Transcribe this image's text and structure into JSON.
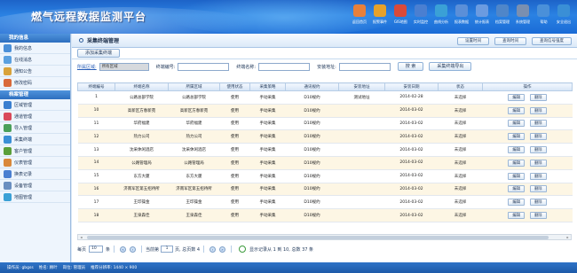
{
  "app": {
    "title": "燃气远程数据监测平台"
  },
  "nav": [
    {
      "label": "返回首页",
      "icon": "home-icon",
      "color": "#e8803a"
    },
    {
      "label": "报警事件",
      "icon": "alarm-bell-icon",
      "color": "#e6a12a"
    },
    {
      "label": "GIS地图",
      "icon": "map-icon",
      "color": "#d94a3a"
    },
    {
      "label": "实时监控",
      "icon": "monitor-icon",
      "color": "#4a7fd1"
    },
    {
      "label": "曲线分析",
      "icon": "curve-chart-icon",
      "color": "#3aa0d6"
    },
    {
      "label": "报表数据",
      "icon": "report-icon",
      "color": "#5b8fd8"
    },
    {
      "label": "统计报表",
      "icon": "statistics-icon",
      "color": "#6b9be0"
    },
    {
      "label": "档案管理",
      "icon": "archive-icon",
      "color": "#4f86c9"
    },
    {
      "label": "系统管理",
      "icon": "system-gear-icon",
      "color": "#7a8fb0"
    },
    {
      "label": "帮助",
      "icon": "help-icon",
      "color": "#4a90d9"
    },
    {
      "label": "安全退出",
      "icon": "logout-icon",
      "color": "#3a8fd6"
    }
  ],
  "sidebar": {
    "header": "我的信息",
    "items": [
      {
        "label": "我的信息",
        "icon": "user-info-icon",
        "color": "#4a8fd8"
      },
      {
        "label": "在线消息",
        "icon": "message-icon",
        "color": "#5aa0e0"
      },
      {
        "label": "通知公告",
        "icon": "notice-icon",
        "color": "#d9a23a"
      },
      {
        "label": "修改密码",
        "icon": "password-icon",
        "color": "#d96a3a"
      }
    ],
    "header2": "档案管理",
    "items2": [
      {
        "label": "区域管理",
        "icon": "region-icon",
        "color": "#3a7fd0"
      },
      {
        "label": "通道管理",
        "icon": "channel-icon",
        "color": "#d94a5a"
      },
      {
        "label": "导入管理",
        "icon": "import-icon",
        "color": "#4aa05a"
      },
      {
        "label": "采集终端",
        "icon": "terminal-icon",
        "color": "#3a8fd6"
      },
      {
        "label": "客户管理",
        "icon": "customer-icon",
        "color": "#5a9f3a"
      },
      {
        "label": "仪表管理",
        "icon": "meter-icon",
        "color": "#d9883a"
      },
      {
        "label": "换表记录",
        "icon": "swap-record-icon",
        "color": "#4a7fd1"
      },
      {
        "label": "设备管理",
        "icon": "device-icon",
        "color": "#6a8fc0"
      },
      {
        "label": "地图管理",
        "icon": "map-manage-icon",
        "color": "#3aa0d6"
      }
    ]
  },
  "page": {
    "title": "采集终端管理",
    "top_buttons": [
      "设置时间",
      "查询时间",
      "查询信号强度"
    ],
    "add_button": "添加采集终端",
    "filters": {
      "region_label": "所属区域:",
      "region_value": "所有区域",
      "terminal_no_label": "终端编号:",
      "terminal_name_label": "终端名称:",
      "install_addr_label": "安装地址:",
      "search_button": "搜 索",
      "export_button": "采集终端导出"
    }
  },
  "table": {
    "headers": [
      "终端编号",
      "终端名称",
      "所属区域",
      "使用状态",
      "采集策略",
      "通讯规约",
      "安装地址",
      "安装日期",
      "状态",
      "操作"
    ],
    "rows": [
      [
        "1",
        "公路总部学院",
        "公路总部学院",
        "使用",
        "手动采集",
        "D10规约",
        "测试地址",
        "2014-02-28",
        "未选择"
      ],
      [
        "10",
        "高新区方春新苑",
        "高新区方春新苑",
        "使用",
        "手动采集",
        "D10规约",
        "",
        "2014-03-02",
        "未选择"
      ],
      [
        "11",
        "华府福建",
        "华府福建",
        "使用",
        "手动采集",
        "D10规约",
        "",
        "2014-03-02",
        "未选择"
      ],
      [
        "12",
        "热力公司",
        "热力公司",
        "使用",
        "手动采集",
        "D10规约",
        "",
        "2014-03-02",
        "未选择"
      ],
      [
        "13",
        "沈采休闲酒店",
        "沈采休闲酒店",
        "使用",
        "手动采集",
        "D10规约",
        "",
        "2014-03-02",
        "未选择"
      ],
      [
        "14",
        "公路管理局",
        "公路管理局",
        "使用",
        "手动采集",
        "D10规约",
        "",
        "2014-03-02",
        "未选择"
      ],
      [
        "15",
        "东方大厦",
        "东方大厦",
        "使用",
        "手动采集",
        "D10规约",
        "",
        "2014-03-02",
        "未选择"
      ],
      [
        "16",
        "济南军区第五招待所",
        "济南军区第五招待所",
        "使用",
        "手动采集",
        "D10规约",
        "",
        "2014-03-02",
        "未选择"
      ],
      [
        "17",
        "王印操金",
        "王印操金",
        "使用",
        "手动采集",
        "D10规约",
        "",
        "2014-03-02",
        "未选择"
      ],
      [
        "18",
        "王泉森佳",
        "王泉森佳",
        "使用",
        "手动采集",
        "D10规约",
        "",
        "2014-03-02",
        "未选择"
      ]
    ],
    "edit_label": "编辑",
    "delete_label": "删除"
  },
  "pager": {
    "per_page_label": "每页",
    "per_page_value": "10",
    "per_page_unit": "条",
    "current_label": "当前第",
    "current_value": "1",
    "total_pages_text": "页, 总页数 4",
    "summary": "显示记录从 1 到 10, 总数 37 条"
  },
  "status": {
    "items": [
      "操作员: gbgss",
      "姓名: 顾叶",
      "岗位: 管理员",
      "推荐分辨率: 1440 × 900"
    ]
  }
}
